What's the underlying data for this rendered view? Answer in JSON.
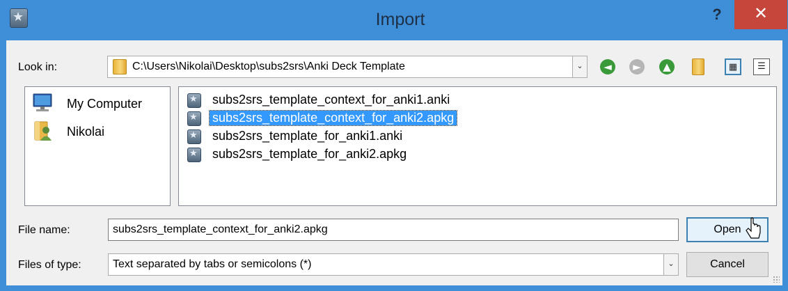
{
  "window": {
    "title": "Import",
    "help_label": "?",
    "close_label": "✕",
    "icon": "anki-star-icon"
  },
  "look_in": {
    "label": "Look in:",
    "path": "C:\\Users\\Nikolai\\Desktop\\subs2srs\\Anki Deck Template",
    "dropdown_arrow": "⌄"
  },
  "toolbar": {
    "back_glyph": "◄",
    "forward_glyph": "►",
    "up_glyph": "▲",
    "list_view_glyph": "▦",
    "detail_view_glyph": "☰",
    "back_color": "#3a9a3a",
    "forward_color": "#b5b5b5",
    "up_color": "#3a9a3a"
  },
  "places": [
    {
      "label": "My Computer",
      "icon": "computer-icon"
    },
    {
      "label": "Nikolai",
      "icon": "user-folder-icon"
    }
  ],
  "files": [
    {
      "name": "subs2srs_template_context_for_anki1.anki",
      "selected": false
    },
    {
      "name": "subs2srs_template_context_for_anki2.apkg",
      "selected": true
    },
    {
      "name": "subs2srs_template_for_anki1.anki",
      "selected": false
    },
    {
      "name": "subs2srs_template_for_anki2.apkg",
      "selected": false
    }
  ],
  "file_name": {
    "label": "File name:",
    "value": "subs2srs_template_context_for_anki2.apkg"
  },
  "file_type": {
    "label": "Files of type:",
    "value": "Text separated by tabs or semicolons (*)",
    "dropdown_arrow": "⌄"
  },
  "buttons": {
    "open": "Open",
    "cancel": "Cancel"
  },
  "colors": {
    "titlebar": "#3f8fd8",
    "close": "#c7463b",
    "selection": "#3399ff"
  }
}
